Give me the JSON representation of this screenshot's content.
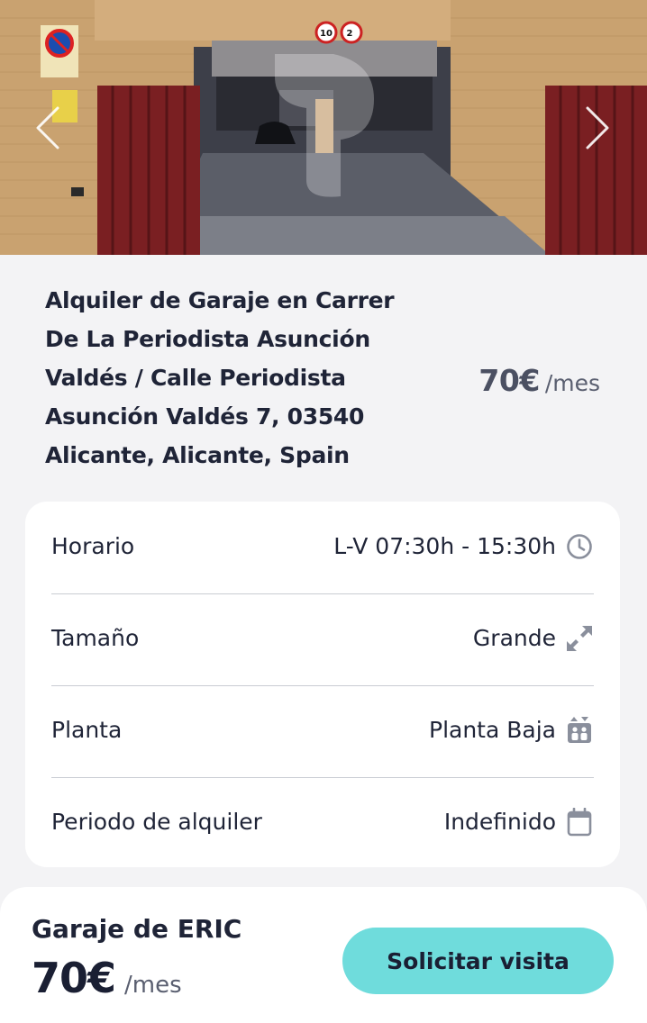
{
  "listing": {
    "title_lines": [
      "Alquiler de Garaje en Carrer",
      "De La Periodista Asunción",
      "Valdés / Calle Periodista",
      "Asunción Valdés 7, 03540",
      "Alicante, Alicante, Spain"
    ],
    "price": "70€",
    "period": "/mes"
  },
  "gallery": {
    "prev_icon": "chevron-left-icon",
    "next_icon": "chevron-right-icon",
    "sign_speed": "10",
    "sign_height": "2"
  },
  "details": [
    {
      "label": "Horario",
      "value": "L-V 07:30h - 15:30h",
      "icon": "clock-icon"
    },
    {
      "label": "Tamaño",
      "value": "Grande",
      "icon": "expand-arrows-icon"
    },
    {
      "label": "Planta",
      "value": "Planta Baja",
      "icon": "elevator-icon"
    },
    {
      "label": "Periodo de alquiler",
      "value": "Indefinido",
      "icon": "calendar-icon"
    }
  ],
  "footer": {
    "owner": "Garaje de ERIC",
    "price": "70€",
    "period": "/mes",
    "cta_label": "Solicitar visita"
  },
  "colors": {
    "accent": "#6fdcdc",
    "text": "#1f2437",
    "icon": "#8a8f9c",
    "background": "#f3f3f5"
  }
}
